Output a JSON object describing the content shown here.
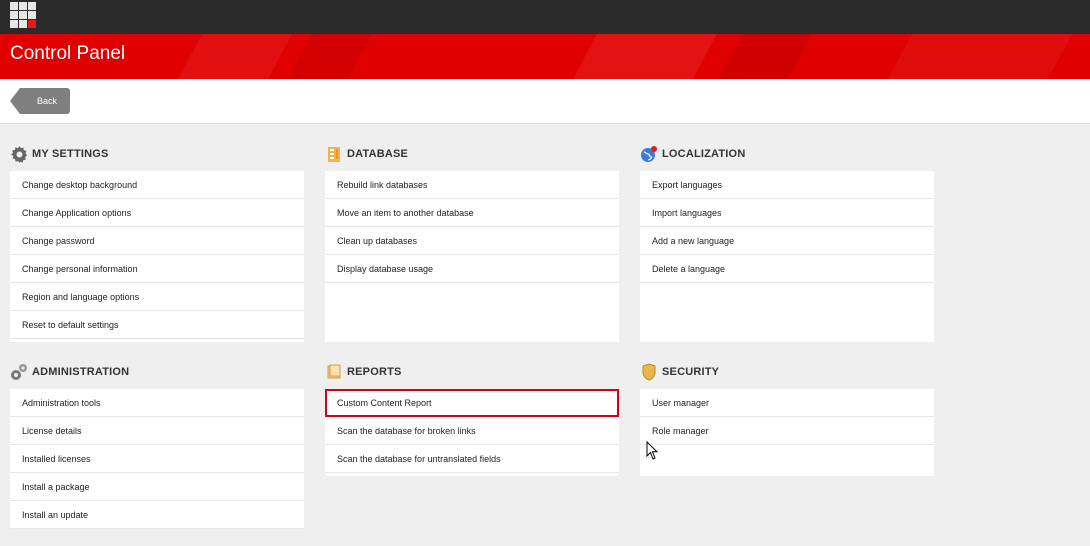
{
  "header": {
    "title": "Control Panel"
  },
  "toolbar": {
    "back_label": "Back"
  },
  "sections": {
    "my_settings": {
      "title": "MY SETTINGS",
      "icon": "gear-icon",
      "items": [
        "Change desktop background",
        "Change Application options",
        "Change password",
        "Change personal information",
        "Region and language options",
        "Reset to default settings"
      ]
    },
    "database": {
      "title": "DATABASE",
      "icon": "database-icon",
      "items": [
        "Rebuild link databases",
        "Move an item to another database",
        "Clean up databases",
        "Display database usage"
      ]
    },
    "localization": {
      "title": "LOCALIZATION",
      "icon": "globe-icon",
      "items": [
        "Export languages",
        "Import languages",
        "Add a new language",
        "Delete a language"
      ]
    },
    "administration": {
      "title": "ADMINISTRATION",
      "icon": "gears-icon",
      "items": [
        "Administration tools",
        "License details",
        "Installed licenses",
        "Install a package",
        "Install an update"
      ]
    },
    "reports": {
      "title": "REPORTS",
      "icon": "report-icon",
      "items": [
        "Custom Content Report",
        "Scan the database for broken links",
        "Scan the database for untranslated fields"
      ]
    },
    "security": {
      "title": "SECURITY",
      "icon": "shield-icon",
      "items": [
        "User manager",
        "Role manager"
      ]
    }
  },
  "colors": {
    "header_red": "#e00000",
    "topbar": "#2b2b2b",
    "highlight": "#d0021b"
  }
}
